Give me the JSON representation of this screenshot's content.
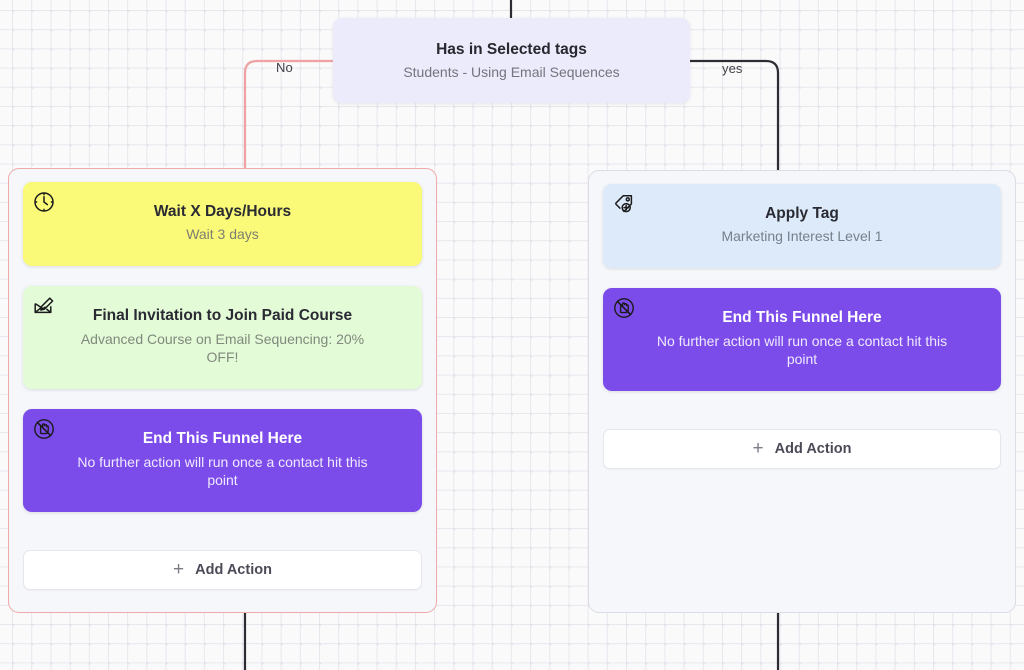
{
  "canvas": {
    "background": "#fafafa",
    "dot_color": "#e3e0e8"
  },
  "decision_node": {
    "name": "has-in-selected-tags",
    "title": "Has in Selected tags",
    "subtitle": "Students - Using Email Sequences",
    "color": "#ecebfb"
  },
  "edges": {
    "no_label": "No",
    "yes_label": "yes",
    "no_color": "#f0a1a1",
    "yes_color": "#2c2c34"
  },
  "branches": [
    {
      "id": "no-branch",
      "border_color": "#f0a9a9",
      "cards": [
        {
          "id": "wait-card",
          "icon": "clock-icon",
          "title": "Wait X Days/Hours",
          "subtitle": "Wait 3 days",
          "color": "#fafa78"
        },
        {
          "id": "email-card",
          "icon": "email-edit-icon",
          "title": "Final Invitation to Join Paid Course",
          "subtitle": "Advanced Course on Email Sequencing: 20% OFF!",
          "color": "#e4fbd8"
        },
        {
          "id": "end-funnel-card",
          "icon": "no-entry-hand-icon",
          "title": "End This Funnel Here",
          "subtitle": "No further action will run once a contact hit this point",
          "color": "#7c4ceb"
        }
      ],
      "add_action": {
        "icon": "plus-icon",
        "label": "Add Action"
      }
    },
    {
      "id": "yes-branch",
      "border_color": "#dcdce6",
      "cards": [
        {
          "id": "apply-tag-card",
          "icon": "tag-plus-icon",
          "title": "Apply Tag",
          "subtitle": "Marketing Interest Level 1",
          "color": "#ddeaf9"
        },
        {
          "id": "end-funnel-card",
          "icon": "no-entry-hand-icon",
          "title": "End This Funnel Here",
          "subtitle": "No further action will run once a contact hit this point",
          "color": "#7c4ceb"
        }
      ],
      "add_action": {
        "icon": "plus-icon",
        "label": "Add Action"
      }
    }
  ]
}
